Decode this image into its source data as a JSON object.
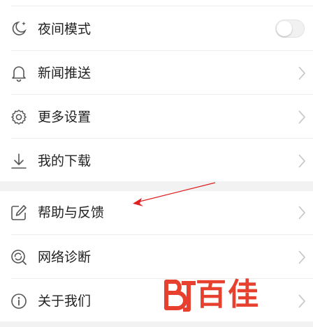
{
  "settings": {
    "night_mode": {
      "label": "夜间模式",
      "toggle_on": false
    },
    "items": [
      {
        "label": "新闻推送",
        "icon": "bell-icon"
      },
      {
        "label": "更多设置",
        "icon": "gear-icon"
      },
      {
        "label": "我的下载",
        "icon": "download-icon"
      },
      {
        "label": "帮助与反馈",
        "icon": "edit-icon"
      },
      {
        "label": "网络诊断",
        "icon": "network-diagnosis-icon"
      },
      {
        "label": "关于我们",
        "icon": "info-icon"
      }
    ]
  },
  "annotation": {
    "arrow_color": "#e02020"
  },
  "watermark": {
    "text": "百佳",
    "color": "#e8402e"
  }
}
